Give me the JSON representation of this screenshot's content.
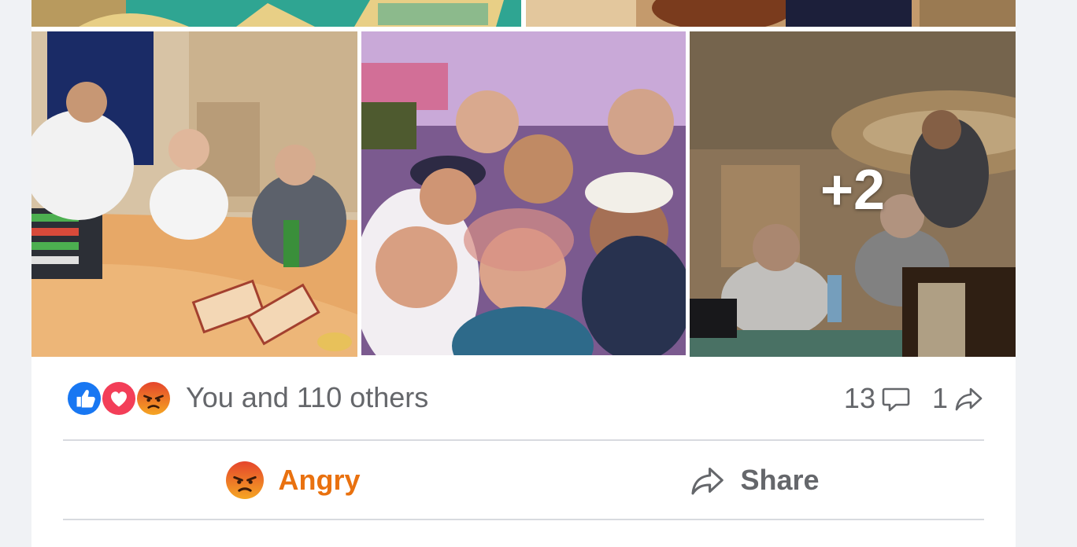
{
  "post": {
    "more_photos_label": "+2",
    "reactions": {
      "icons": [
        "like-icon",
        "love-icon",
        "angry-icon"
      ],
      "summary": "You and 110 others"
    },
    "comments_count": "13",
    "shares_count": "1",
    "actions": {
      "angry_label": "Angry",
      "share_label": "Share"
    },
    "colors": {
      "like": "#1877f2",
      "love": "#f33e58",
      "angry": "#e9710f",
      "secondary_text": "#65676b"
    }
  }
}
